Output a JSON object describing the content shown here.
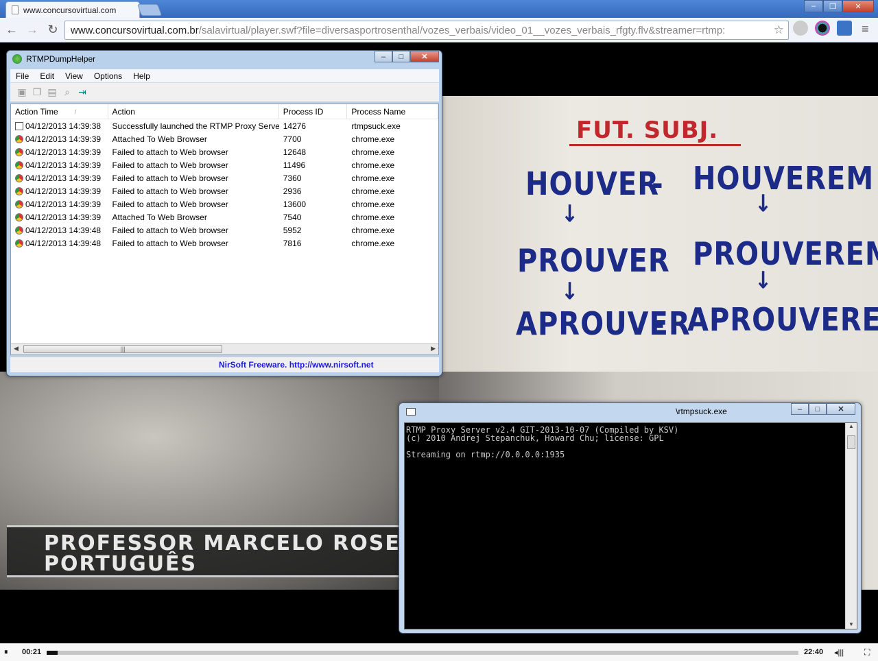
{
  "browser": {
    "tab_title": "www.concursovirtual.com",
    "url_host": "www.concursovirtual.com.br",
    "url_path": "/salavirtual/player.swf?file=diversasportrosenthal/vozes_verbais/video_01__vozes_verbais_rfgty.flv&streamer=rtmp:"
  },
  "video": {
    "board": {
      "title": "FUT. SUBJ.",
      "row1_left": "HOUVER",
      "row1_right": "HOUVEREM",
      "row2_left": "PROUVER",
      "row2_right": "PROUVEREM",
      "row3_left": "APROUVER",
      "row3_right": "APROUVEREM",
      "arrow": "↓",
      "dash": "-"
    },
    "lower_third": {
      "line1": "PROFESSOR MARCELO ROSE",
      "line2": "PORTUGUÊS"
    },
    "player": {
      "pause_icon": "⏸",
      "current_time": "00:21",
      "total_time": "22:40",
      "progress": 0.015
    }
  },
  "rtmpdump": {
    "title": "RTMPDumpHelper",
    "menu": [
      "File",
      "Edit",
      "View",
      "Options",
      "Help"
    ],
    "columns": [
      "Action Time",
      "Action",
      "Process ID",
      "Process Name"
    ],
    "rows": [
      {
        "time": "04/12/2013 14:39:38",
        "action": "Successfully launched the RTMP Proxy Server",
        "pid": "14276",
        "name": "rtmpsuck.exe",
        "icon": "app-icon"
      },
      {
        "time": "04/12/2013 14:39:39",
        "action": "Attached To Web Browser",
        "pid": "7700",
        "name": "chrome.exe",
        "icon": "chrome-icon"
      },
      {
        "time": "04/12/2013 14:39:39",
        "action": "Failed to attach to Web browser",
        "pid": "12648",
        "name": "chrome.exe",
        "icon": "chrome-icon"
      },
      {
        "time": "04/12/2013 14:39:39",
        "action": "Failed to attach to Web browser",
        "pid": "11496",
        "name": "chrome.exe",
        "icon": "chrome-icon"
      },
      {
        "time": "04/12/2013 14:39:39",
        "action": "Failed to attach to Web browser",
        "pid": "7360",
        "name": "chrome.exe",
        "icon": "chrome-icon"
      },
      {
        "time": "04/12/2013 14:39:39",
        "action": "Failed to attach to Web browser",
        "pid": "2936",
        "name": "chrome.exe",
        "icon": "chrome-icon"
      },
      {
        "time": "04/12/2013 14:39:39",
        "action": "Failed to attach to Web browser",
        "pid": "13600",
        "name": "chrome.exe",
        "icon": "chrome-icon"
      },
      {
        "time": "04/12/2013 14:39:39",
        "action": "Attached To Web Browser",
        "pid": "7540",
        "name": "chrome.exe",
        "icon": "chrome-icon"
      },
      {
        "time": "04/12/2013 14:39:48",
        "action": "Failed to attach to Web browser",
        "pid": "5952",
        "name": "chrome.exe",
        "icon": "chrome-icon"
      },
      {
        "time": "04/12/2013 14:39:48",
        "action": "Failed to attach to Web browser",
        "pid": "7816",
        "name": "chrome.exe",
        "icon": "chrome-icon"
      }
    ],
    "status": "NirSoft Freeware.  http://www.nirsoft.net"
  },
  "rtmpsuck": {
    "title": "\\rtmpsuck.exe",
    "console_lines": [
      "RTMP Proxy Server v2.4 GIT-2013-10-07 (Compiled by KSV)",
      "(c) 2010 Andrej Stepanchuk, Howard Chu; license: GPL",
      "",
      "Streaming on rtmp://0.0.0.0:1935"
    ]
  }
}
